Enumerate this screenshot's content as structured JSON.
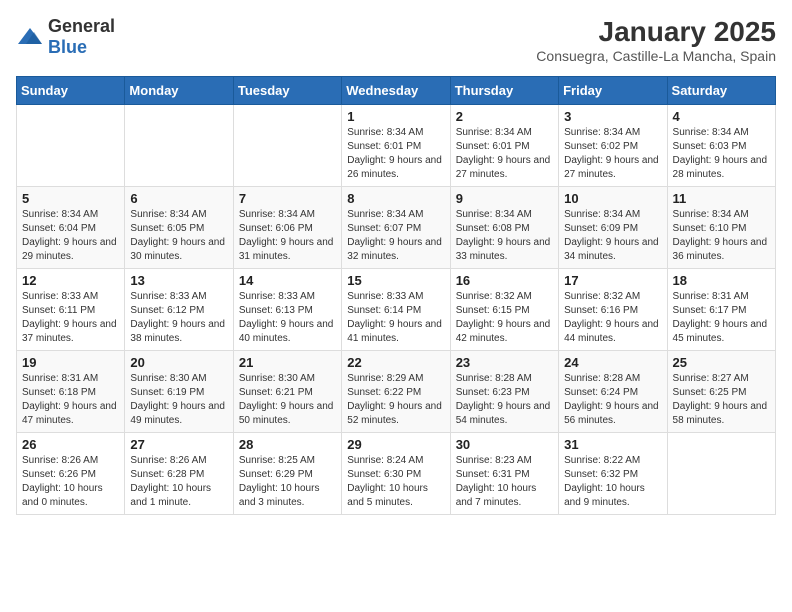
{
  "logo": {
    "general": "General",
    "blue": "Blue"
  },
  "header": {
    "month": "January 2025",
    "location": "Consuegra, Castille-La Mancha, Spain"
  },
  "days_of_week": [
    "Sunday",
    "Monday",
    "Tuesday",
    "Wednesday",
    "Thursday",
    "Friday",
    "Saturday"
  ],
  "weeks": [
    [
      {
        "day": "",
        "sunrise": "",
        "sunset": "",
        "daylight": ""
      },
      {
        "day": "",
        "sunrise": "",
        "sunset": "",
        "daylight": ""
      },
      {
        "day": "",
        "sunrise": "",
        "sunset": "",
        "daylight": ""
      },
      {
        "day": "1",
        "sunrise": "Sunrise: 8:34 AM",
        "sunset": "Sunset: 6:01 PM",
        "daylight": "Daylight: 9 hours and 26 minutes."
      },
      {
        "day": "2",
        "sunrise": "Sunrise: 8:34 AM",
        "sunset": "Sunset: 6:01 PM",
        "daylight": "Daylight: 9 hours and 27 minutes."
      },
      {
        "day": "3",
        "sunrise": "Sunrise: 8:34 AM",
        "sunset": "Sunset: 6:02 PM",
        "daylight": "Daylight: 9 hours and 27 minutes."
      },
      {
        "day": "4",
        "sunrise": "Sunrise: 8:34 AM",
        "sunset": "Sunset: 6:03 PM",
        "daylight": "Daylight: 9 hours and 28 minutes."
      }
    ],
    [
      {
        "day": "5",
        "sunrise": "Sunrise: 8:34 AM",
        "sunset": "Sunset: 6:04 PM",
        "daylight": "Daylight: 9 hours and 29 minutes."
      },
      {
        "day": "6",
        "sunrise": "Sunrise: 8:34 AM",
        "sunset": "Sunset: 6:05 PM",
        "daylight": "Daylight: 9 hours and 30 minutes."
      },
      {
        "day": "7",
        "sunrise": "Sunrise: 8:34 AM",
        "sunset": "Sunset: 6:06 PM",
        "daylight": "Daylight: 9 hours and 31 minutes."
      },
      {
        "day": "8",
        "sunrise": "Sunrise: 8:34 AM",
        "sunset": "Sunset: 6:07 PM",
        "daylight": "Daylight: 9 hours and 32 minutes."
      },
      {
        "day": "9",
        "sunrise": "Sunrise: 8:34 AM",
        "sunset": "Sunset: 6:08 PM",
        "daylight": "Daylight: 9 hours and 33 minutes."
      },
      {
        "day": "10",
        "sunrise": "Sunrise: 8:34 AM",
        "sunset": "Sunset: 6:09 PM",
        "daylight": "Daylight: 9 hours and 34 minutes."
      },
      {
        "day": "11",
        "sunrise": "Sunrise: 8:34 AM",
        "sunset": "Sunset: 6:10 PM",
        "daylight": "Daylight: 9 hours and 36 minutes."
      }
    ],
    [
      {
        "day": "12",
        "sunrise": "Sunrise: 8:33 AM",
        "sunset": "Sunset: 6:11 PM",
        "daylight": "Daylight: 9 hours and 37 minutes."
      },
      {
        "day": "13",
        "sunrise": "Sunrise: 8:33 AM",
        "sunset": "Sunset: 6:12 PM",
        "daylight": "Daylight: 9 hours and 38 minutes."
      },
      {
        "day": "14",
        "sunrise": "Sunrise: 8:33 AM",
        "sunset": "Sunset: 6:13 PM",
        "daylight": "Daylight: 9 hours and 40 minutes."
      },
      {
        "day": "15",
        "sunrise": "Sunrise: 8:33 AM",
        "sunset": "Sunset: 6:14 PM",
        "daylight": "Daylight: 9 hours and 41 minutes."
      },
      {
        "day": "16",
        "sunrise": "Sunrise: 8:32 AM",
        "sunset": "Sunset: 6:15 PM",
        "daylight": "Daylight: 9 hours and 42 minutes."
      },
      {
        "day": "17",
        "sunrise": "Sunrise: 8:32 AM",
        "sunset": "Sunset: 6:16 PM",
        "daylight": "Daylight: 9 hours and 44 minutes."
      },
      {
        "day": "18",
        "sunrise": "Sunrise: 8:31 AM",
        "sunset": "Sunset: 6:17 PM",
        "daylight": "Daylight: 9 hours and 45 minutes."
      }
    ],
    [
      {
        "day": "19",
        "sunrise": "Sunrise: 8:31 AM",
        "sunset": "Sunset: 6:18 PM",
        "daylight": "Daylight: 9 hours and 47 minutes."
      },
      {
        "day": "20",
        "sunrise": "Sunrise: 8:30 AM",
        "sunset": "Sunset: 6:19 PM",
        "daylight": "Daylight: 9 hours and 49 minutes."
      },
      {
        "day": "21",
        "sunrise": "Sunrise: 8:30 AM",
        "sunset": "Sunset: 6:21 PM",
        "daylight": "Daylight: 9 hours and 50 minutes."
      },
      {
        "day": "22",
        "sunrise": "Sunrise: 8:29 AM",
        "sunset": "Sunset: 6:22 PM",
        "daylight": "Daylight: 9 hours and 52 minutes."
      },
      {
        "day": "23",
        "sunrise": "Sunrise: 8:28 AM",
        "sunset": "Sunset: 6:23 PM",
        "daylight": "Daylight: 9 hours and 54 minutes."
      },
      {
        "day": "24",
        "sunrise": "Sunrise: 8:28 AM",
        "sunset": "Sunset: 6:24 PM",
        "daylight": "Daylight: 9 hours and 56 minutes."
      },
      {
        "day": "25",
        "sunrise": "Sunrise: 8:27 AM",
        "sunset": "Sunset: 6:25 PM",
        "daylight": "Daylight: 9 hours and 58 minutes."
      }
    ],
    [
      {
        "day": "26",
        "sunrise": "Sunrise: 8:26 AM",
        "sunset": "Sunset: 6:26 PM",
        "daylight": "Daylight: 10 hours and 0 minutes."
      },
      {
        "day": "27",
        "sunrise": "Sunrise: 8:26 AM",
        "sunset": "Sunset: 6:28 PM",
        "daylight": "Daylight: 10 hours and 1 minute."
      },
      {
        "day": "28",
        "sunrise": "Sunrise: 8:25 AM",
        "sunset": "Sunset: 6:29 PM",
        "daylight": "Daylight: 10 hours and 3 minutes."
      },
      {
        "day": "29",
        "sunrise": "Sunrise: 8:24 AM",
        "sunset": "Sunset: 6:30 PM",
        "daylight": "Daylight: 10 hours and 5 minutes."
      },
      {
        "day": "30",
        "sunrise": "Sunrise: 8:23 AM",
        "sunset": "Sunset: 6:31 PM",
        "daylight": "Daylight: 10 hours and 7 minutes."
      },
      {
        "day": "31",
        "sunrise": "Sunrise: 8:22 AM",
        "sunset": "Sunset: 6:32 PM",
        "daylight": "Daylight: 10 hours and 9 minutes."
      },
      {
        "day": "",
        "sunrise": "",
        "sunset": "",
        "daylight": ""
      }
    ]
  ]
}
